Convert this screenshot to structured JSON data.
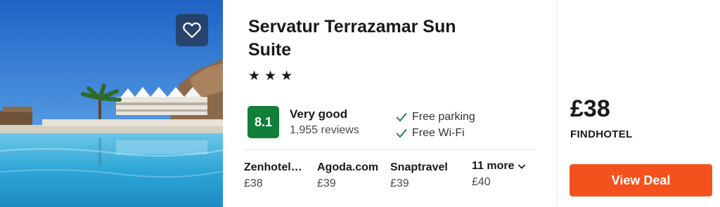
{
  "hotel": {
    "name": "Servatur Terrazamar Sun Suite",
    "stars": 3,
    "star_glyph": "★"
  },
  "rating": {
    "score": "8.1",
    "label": "Very good",
    "reviews": "1,955 reviews",
    "badge_color": "#117e39"
  },
  "amenities": [
    {
      "label": "Free parking",
      "icon": "check-icon"
    },
    {
      "label": "Free Wi-Fi",
      "icon": "check-icon"
    }
  ],
  "providers": [
    {
      "name": "Zenhotel…",
      "price": "£38"
    },
    {
      "name": "Agoda.com",
      "price": "£39"
    },
    {
      "name": "Snaptravel",
      "price": "£39"
    }
  ],
  "more_providers": {
    "label": "11 more",
    "price": "£40",
    "icon": "chevron-down-icon"
  },
  "deal": {
    "price": "£38",
    "provider": "FINDHOTEL",
    "button_label": "View Deal",
    "button_color": "#f5511d"
  },
  "favorite": {
    "icon": "heart-icon"
  }
}
